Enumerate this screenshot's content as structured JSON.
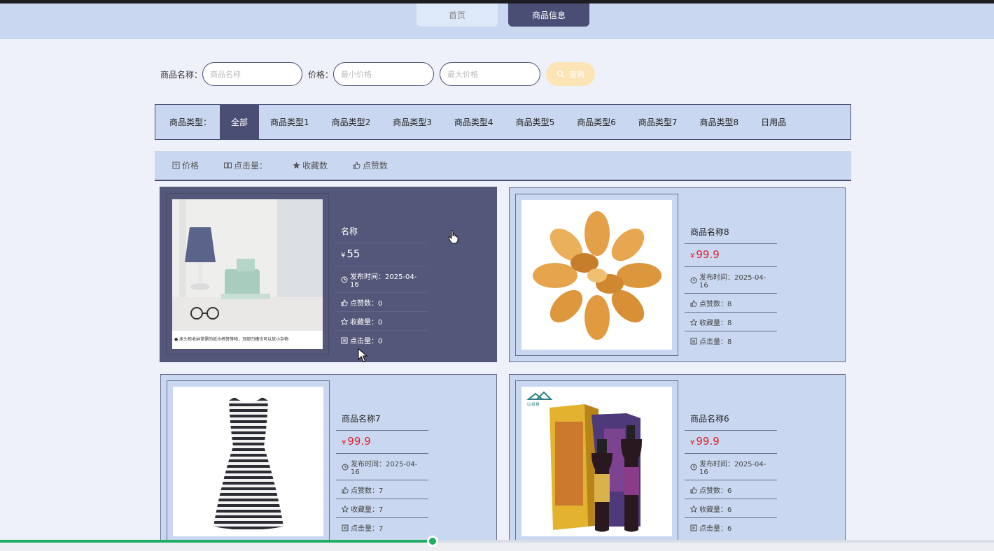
{
  "nav": {
    "tabs": [
      {
        "label": "首页"
      },
      {
        "label": "商品信息"
      }
    ]
  },
  "search": {
    "name_label": "商品名称：",
    "name_placeholder": "商品名称",
    "price_label": "价格：",
    "min_placeholder": "最小价格",
    "max_placeholder": "最大价格",
    "button_label": "查询"
  },
  "types": {
    "label": "商品类型：",
    "items": [
      "全部",
      "商品类型1",
      "商品类型2",
      "商品类型3",
      "商品类型4",
      "商品类型5",
      "商品类型6",
      "商品类型7",
      "商品类型8",
      "日用品"
    ],
    "active": "全部"
  },
  "sort": {
    "items": [
      {
        "label": "价格",
        "icon": "price-icon"
      },
      {
        "label": "点击量：",
        "icon": "book-icon"
      },
      {
        "label": "收藏数",
        "icon": "star-icon"
      },
      {
        "label": "点赞数",
        "icon": "thumb-icon"
      }
    ]
  },
  "products": [
    {
      "name": "名称",
      "currency": "¥",
      "price": "55",
      "publish": "发布时间：2025-04-16",
      "likes": "点赞数：0",
      "favorites": "收藏量：0",
      "clicks": "点击量：0",
      "caption": "● 床头柜收纳常需的纸巾椅答等物，顶部凹槽也可以放小杂物"
    },
    {
      "name": "商品名称8",
      "currency": "¥",
      "price": "99.9",
      "publish": "发布时间：2025-04-16",
      "likes": "点赞数：8",
      "favorites": "收藏量：8",
      "clicks": "点击量：8"
    },
    {
      "name": "商品名称7",
      "currency": "¥",
      "price": "99.9",
      "publish": "发布时间：2025-04-16",
      "likes": "点赞数：7",
      "favorites": "收藏量：7",
      "clicks": "点击量：7"
    },
    {
      "name": "商品名称6",
      "currency": "¥",
      "price": "99.9",
      "publish": "发布时间：2025-04-16",
      "likes": "点赞数：6",
      "favorites": "收藏量：6",
      "clicks": "点击量：6",
      "brand": "山谷食"
    }
  ],
  "player": {
    "progress": 0.435
  },
  "colors": {
    "accent": "#4a4d74",
    "panel": "#c9d8f0",
    "price": "#e0202a",
    "progress": "#1fae63"
  }
}
